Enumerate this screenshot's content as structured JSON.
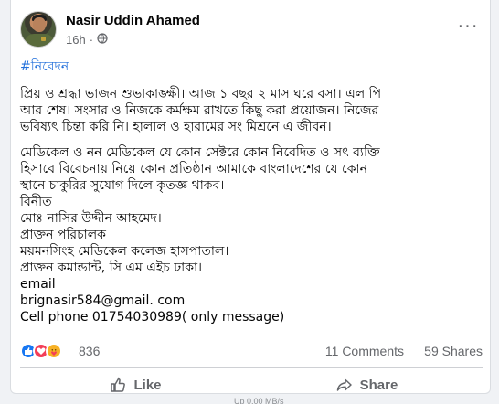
{
  "post": {
    "author": "Nasir Uddin Ahamed",
    "time": "16h",
    "time_separator": "·",
    "privacy_icon": "globe-icon",
    "more_icon": "more-horizontal-icon",
    "more_label": "···",
    "hashtag": "#নিবেদন",
    "lines": [
      "প্রিয় ও শ্রদ্ধা ভাজন শুভাকাঙ্ক্ষী।  আজ ১ বছর ২ মাস ঘরে বসা। এল পি",
      "আর শেষ। সংসার ও নিজকে কর্মক্ষম রাখতে কিছু করা প্রয়োজন।  নিজের",
      "ভবিষ্যৎ চিন্তা করি নি। হালাল ও হারামের সং মিশ্রনে এ জীবন।",
      "মেডিকেল ও নন মেডিকেল যে কোন সেক্টরে কোন নিবেদিত ও সৎ ব্যক্তি",
      "হিসাবে  বিবেচনায় নিয়ে কোন প্রতিষ্ঠান আমাকে বাংলাদেশের যে কোন",
      "স্থানে   চাকুরির সুযোগ দিলে কৃতজ্ঞ থাকব।",
      "বিনীত",
      "মোঃ নাসির উদ্দীন আহমেদ।",
      "প্রাক্তন পরিচালক",
      "ময়মনসিংহ মেডিকেল কলেজ হাসপাতাল।",
      "প্রাক্তন কমান্ডান্ট, সি এম এইচ ঢাকা।",
      "email",
      "brignasir584@gmail. com",
      "Cell phone  01754030989( only message)"
    ]
  },
  "stats": {
    "reaction_icons": [
      "like-icon",
      "love-icon",
      "care-icon"
    ],
    "reaction_count": "836",
    "comments": "11 Comments",
    "shares": "59 Shares"
  },
  "actions": {
    "like": "Like",
    "share": "Share"
  },
  "overlay_text": "Up  0.00 MB/s",
  "colors": {
    "link": "#216fdb",
    "secondary_text": "#65676b",
    "like_blue": "#1877f2",
    "love_red": "#f33e58",
    "care_yellow": "#f7b125"
  }
}
